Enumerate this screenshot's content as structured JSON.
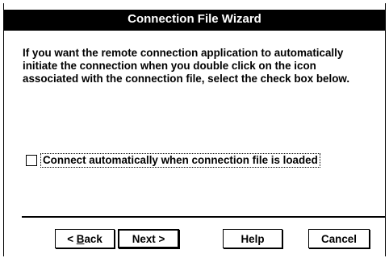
{
  "window": {
    "title": "Connection File Wizard"
  },
  "content": {
    "instructions": "If you want the remote connection application to automatically initiate the connection when you double click on the icon associated with the connection file, select the check box below."
  },
  "options": {
    "auto_connect": {
      "label": "Connect automatically when connection file is loaded",
      "checked": false
    }
  },
  "buttons": {
    "back": {
      "prefix": "< ",
      "mnemonic": "B",
      "rest": "ack"
    },
    "next": "Next >",
    "help": "Help",
    "cancel": "Cancel"
  }
}
